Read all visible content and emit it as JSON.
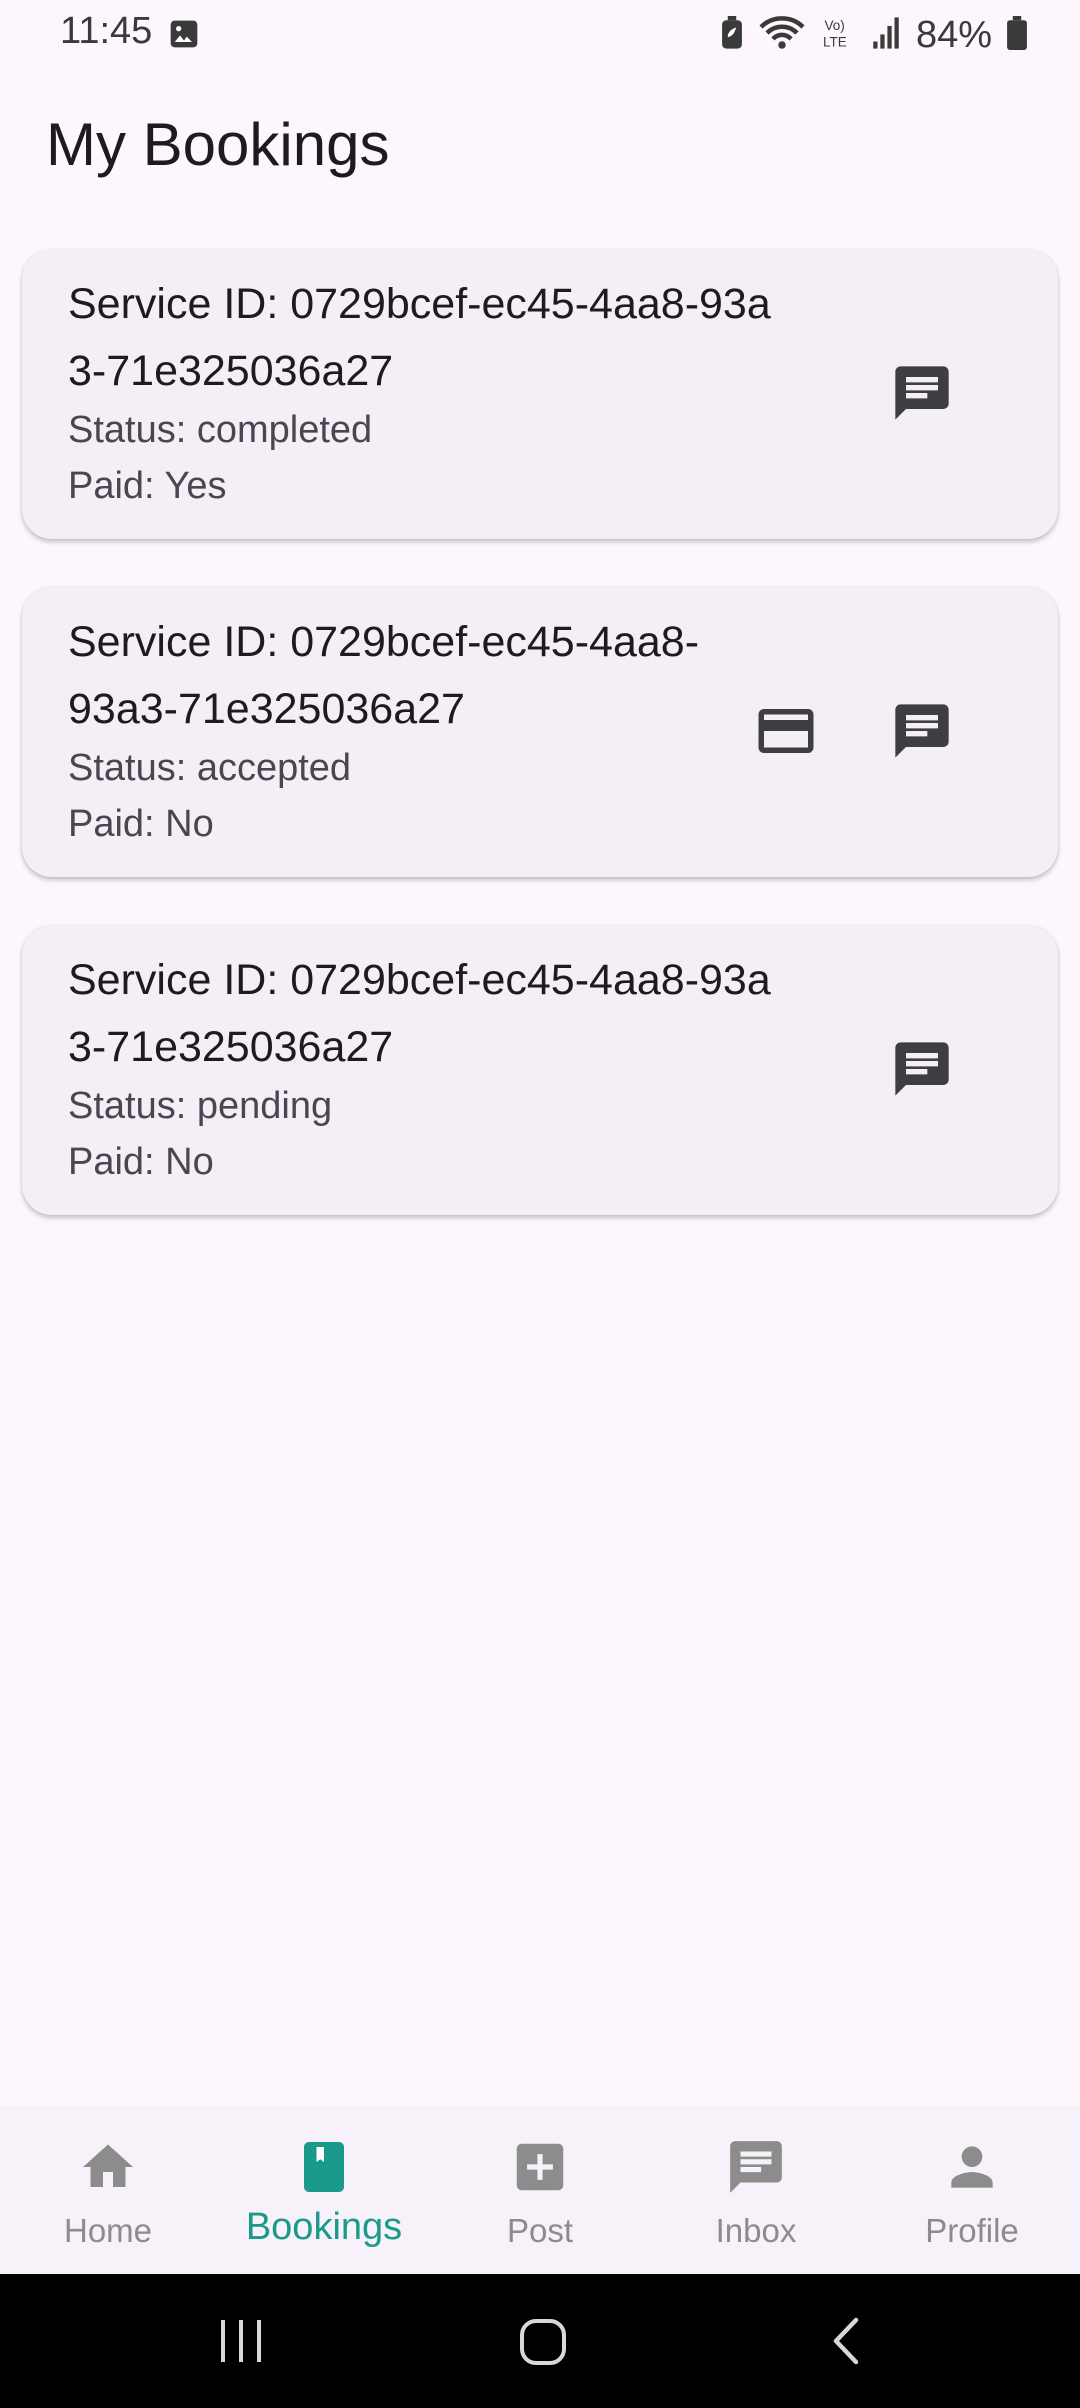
{
  "status_bar": {
    "time": "11:45",
    "battery": "84%",
    "icons": [
      "image-icon",
      "battery-saver-icon",
      "wifi-icon",
      "volte-icon",
      "signal-icon",
      "battery-icon"
    ]
  },
  "page": {
    "title": "My Bookings"
  },
  "bookings": [
    {
      "service_id": "Service ID: 0729bcef-ec45-4aa8-93a3-71e325036a27",
      "status": "Status: completed",
      "paid": "Paid: Yes",
      "actions": [
        "chat-icon"
      ]
    },
    {
      "service_id": "Service ID: 0729bcef-ec45-4aa8-93a3-71e325036a27",
      "status": "Status: accepted",
      "paid": "Paid: No",
      "actions": [
        "credit-card-icon",
        "chat-icon"
      ]
    },
    {
      "service_id": "Service ID: 0729bcef-ec45-4aa8-93a3-71e325036a27",
      "status": "Status: pending",
      "paid": "Paid: No",
      "actions": [
        "chat-icon"
      ]
    }
  ],
  "bottom_nav": {
    "items": [
      {
        "label": "Home",
        "icon": "home-icon",
        "active": false
      },
      {
        "label": "Bookings",
        "icon": "bookings-icon",
        "active": true
      },
      {
        "label": "Post",
        "icon": "add-box-icon",
        "active": false
      },
      {
        "label": "Inbox",
        "icon": "chat-icon",
        "active": false
      },
      {
        "label": "Profile",
        "icon": "person-icon",
        "active": false
      }
    ]
  },
  "colors": {
    "background": "#fdf7fd",
    "card": "#f4eff6",
    "accent": "#1a9a8a",
    "icon_dark": "#3f3d44",
    "nav_inactive": "#8c8c8c"
  }
}
